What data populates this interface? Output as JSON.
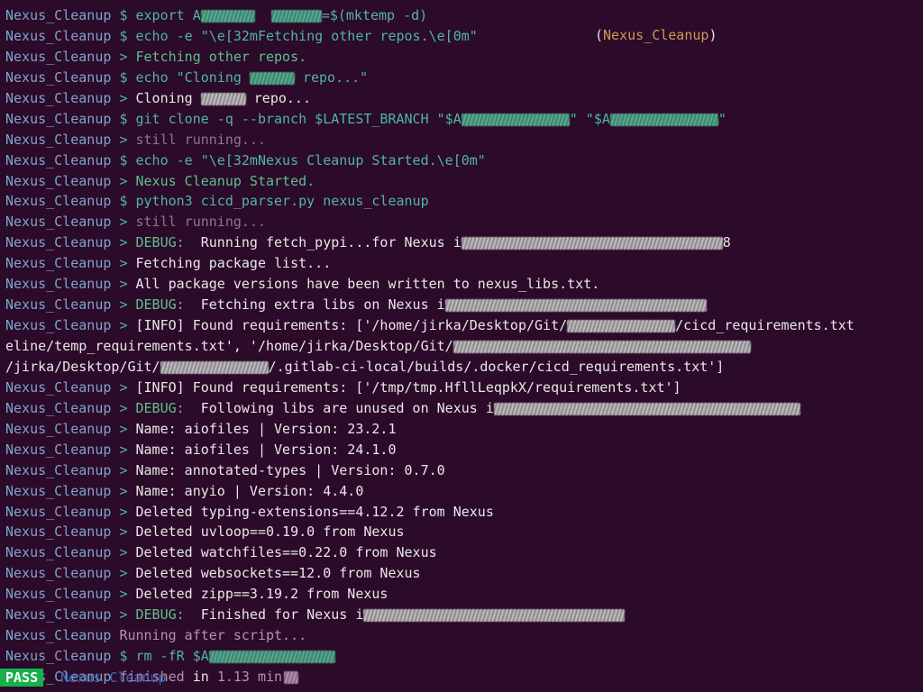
{
  "job": "Nexus_Cleanup",
  "tag": "Nexus_Cleanup",
  "lines": {
    "l0_cmd": "export A",
    "l0_tail": "=$(mktemp -d)",
    "l1_cmd": "echo -e \"\\e[32mFetching other repos.\\e[0m\"",
    "l2_out": "Fetching other repos.",
    "l3_cmd": "echo \"Cloning ",
    "l3_tail": " repo...\"",
    "l4_out_a": "Cloning ",
    "l4_out_b": " repo...",
    "l5_cmd": "git clone -q --branch $LATEST_BRANCH \"$A",
    "l5_mid": "\" \"$A",
    "l5_end": "\"",
    "l6_dim": "still running...",
    "l7_cmd": "echo -e \"\\e[32mNexus Cleanup Started.\\e[0m\"",
    "l8_out": "Nexus Cleanup Started.",
    "l9_cmd": "python3 cicd_parser.py nexus_cleanup",
    "l10_dim": "still running...",
    "l11_debug": "DEBUG:",
    "l11_msg": "  Running fetch_pypi...for Nexus i",
    "l11_tail": "8",
    "l12_out": "Fetching package list...",
    "l13_out": "All package versions have been written to nexus_libs.txt.",
    "l14_msg": "  Fetching extra libs on Nexus i",
    "l15_out_a": "[INFO] Found requirements: ['/home/jirka/Desktop/Git/",
    "l15_out_b": "/cicd_requirements.txt",
    "l16_a": "eline/temp_requirements.txt', '/home/jirka/Desktop/Git/",
    "l17_a": "/jirka/Desktop/Git/",
    "l17_b": "/.gitlab-ci-local/builds/.docker/cicd_requirements.txt']",
    "l18_out": "[INFO] Found requirements: ['/tmp/tmp.HfllLeqpkX/requirements.txt']",
    "l19_msg": "  Following libs are unused on Nexus i",
    "l20": "Name: aiofiles | Version: 23.2.1",
    "l21": "Name: aiofiles | Version: 24.1.0",
    "l22": "Name: annotated-types | Version: 0.7.0",
    "l23": "Name: anyio | Version: 4.4.0",
    "l24": "Deleted typing-extensions==4.12.2 from Nexus",
    "l25": "Deleted uvloop==0.19.0 from Nexus",
    "l26": "Deleted watchfiles==0.22.0 from Nexus",
    "l27": "Deleted websockets==12.0 from Nexus",
    "l28": "Deleted zipp==3.19.2 from Nexus",
    "l29_msg": "  Finished for Nexus i",
    "l30": "Running after script...",
    "l31_cmd": "rm -fR $A",
    "l32_a": "finished",
    "l32_b": " in ",
    "l32_c": "1.13 min"
  },
  "pass": "PASS",
  "passjob": "Nexus Cleanup"
}
